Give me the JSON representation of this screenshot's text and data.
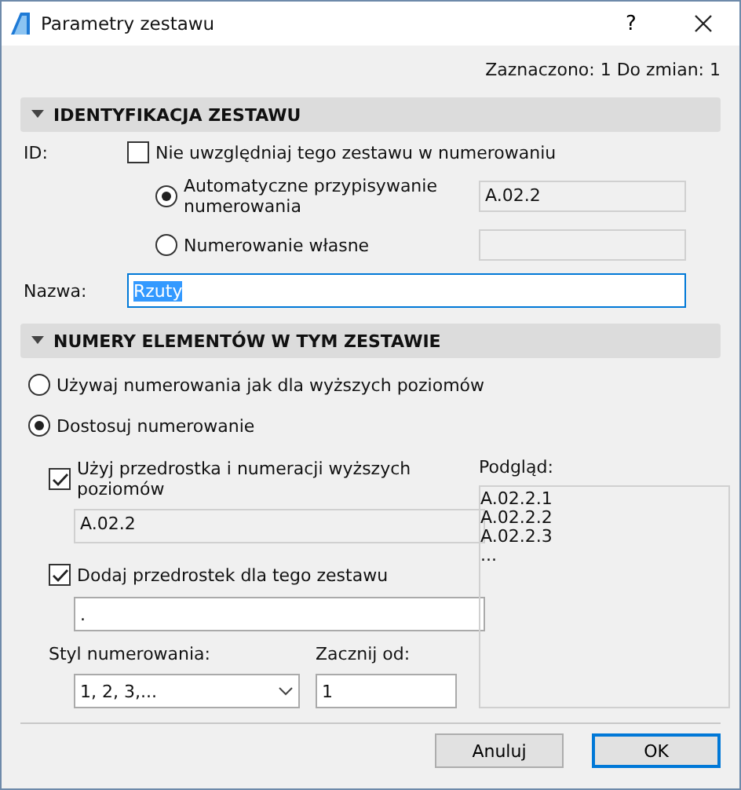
{
  "window": {
    "title": "Parametry zestawu",
    "help": "?"
  },
  "status": "Zaznaczono: 1 Do zmian: 1",
  "identification": {
    "title": "IDENTYFIKACJA ZESTAWU",
    "expanded": true,
    "id_label": "ID:",
    "exclude": {
      "label": "Nie uwzględniaj tego zestawu w numerowaniu",
      "checked": false
    },
    "options": [
      {
        "label": "Automatyczne przypisywanie numerowania",
        "selected": true,
        "value": "A.02.2"
      },
      {
        "label": "Numerowanie własne",
        "selected": false
      }
    ],
    "name_label": "Nazwa:",
    "name_value": "Rzuty"
  },
  "numbering": {
    "title": "NUMERY ELEMENTÓW W TYM ZESTAWIE",
    "expanded": true,
    "modes": [
      {
        "label": "Używaj numerowania jak dla wyższych poziomów",
        "selected": false
      },
      {
        "label": "Dostosuj numerowanie",
        "selected": true
      }
    ],
    "use_prefix": {
      "label": "Użyj przedrostka i numeracji wyższych poziomów",
      "checked": true,
      "value": "A.02.2"
    },
    "add_prefix": {
      "label": "Dodaj przedrostek dla tego zestawu",
      "checked": true,
      "value": "."
    },
    "style_label": "Styl numerowania:",
    "style_value": "1, 2, 3,...",
    "start_label": "Zacznij od:",
    "start_value": "1",
    "preview_label": "Podgląd:",
    "preview_lines": [
      "A.02.2.1",
      "A.02.2.2",
      "A.02.2.3",
      "..."
    ]
  },
  "buttons": [
    {
      "label": "Anuluj",
      "default": false
    },
    {
      "label": "OK",
      "default": true
    }
  ]
}
